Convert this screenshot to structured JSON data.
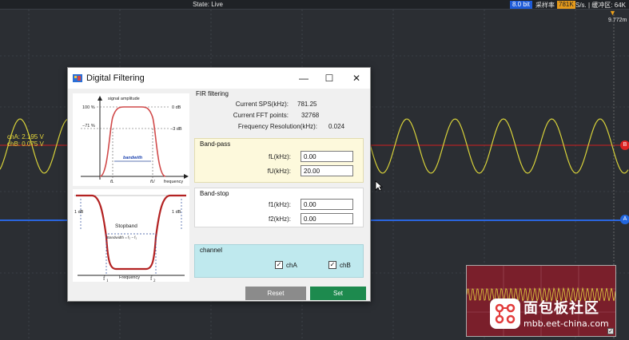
{
  "topbar": {
    "state": "State: Live",
    "bit_depth": "8.0 bit",
    "sample_label": "采样率",
    "sample_rate": "781K",
    "sample_unit": "S/s. | 缓冲区: 64K",
    "trigger_time": "9.772m"
  },
  "channels": {
    "cha_label": "chA: 2.195 V",
    "chb_label": "chB: 0.075 V",
    "chb_marker": "B",
    "cha_marker": "A"
  },
  "dialog": {
    "title": "Digital Filtering",
    "min_glyph": "—",
    "max_glyph": "☐",
    "close_glyph": "✕",
    "fir": {
      "title": "FIR filtering",
      "rows": [
        {
          "label": "Current SPS(kHz):",
          "value": "781.25"
        },
        {
          "label": "Current FFT points:",
          "value": "32768"
        },
        {
          "label": "Frequency Resolution(kHz):",
          "value": "0.024"
        }
      ]
    },
    "bandpass": {
      "title": "Band-pass",
      "fl_label": "fL(kHz):",
      "fl_value": "0.00",
      "fu_label": "fU(kHz):",
      "fu_value": "20.00"
    },
    "bandstop": {
      "title": "Band-stop",
      "f1_label": "f1(kHz):",
      "f1_value": "0.00",
      "f2_label": "f2(kHz):",
      "f2_value": "0.00"
    },
    "channel": {
      "title": "channel",
      "cha": "chA",
      "chb": "chB",
      "check_glyph": "✓"
    },
    "reset_label": "Reset",
    "set_label": "Set"
  },
  "diagram_bandpass": {
    "amp_label": "signal amplitude",
    "pct100": "100 %",
    "pct71": "−71 %",
    "db0": "0 dB",
    "db3": "−3 dB",
    "bandwidth": "bandwith",
    "fl": "fL",
    "fu": "fU",
    "frequency": "frequency"
  },
  "diagram_bandstop": {
    "db_left": "1 dB",
    "db_right": "1 dB",
    "stopband": "Stopband",
    "bandwidth": "Bandwidth = f₂ − f₁",
    "f1": "f",
    "f1_sub": "1",
    "frequency": "Frequency",
    "f2": "f",
    "f2_sub": "2"
  },
  "watermark": {
    "title": "面包板社区",
    "url": "mbb.eet-china.com"
  },
  "colors": {
    "trace_yellow": "#d8d23a",
    "ref_red": "#d02020",
    "ref_blue": "#2a66e0",
    "set_green": "#1d8a4e",
    "bandpass_bg": "#fdf9dc",
    "channel_bg": "#bfe9ee"
  }
}
